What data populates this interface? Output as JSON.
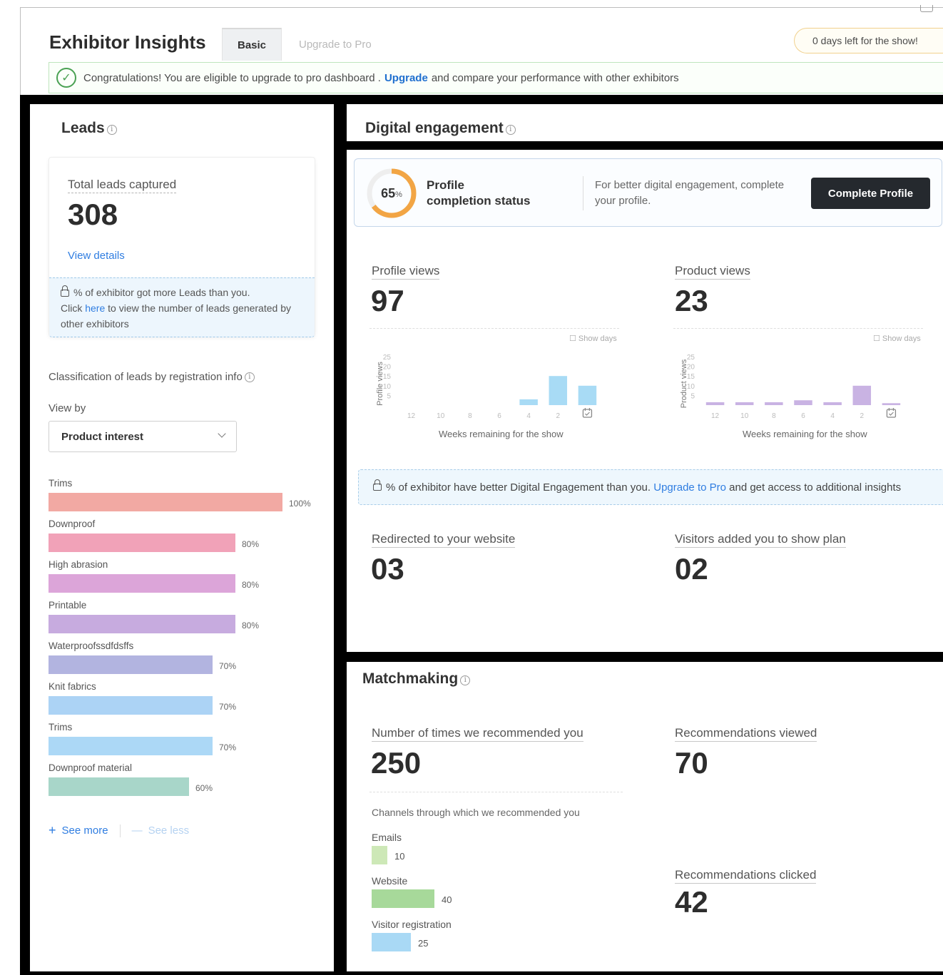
{
  "header": {
    "title": "Exhibitor Insights",
    "tabs": [
      {
        "label": "Basic"
      },
      {
        "label": "Upgrade to Pro"
      }
    ],
    "days_left": "0 days left for the show!",
    "banner": {
      "text_before": "Congratulations! You are eligible to upgrade to pro dashboard .",
      "link": "Upgrade",
      "text_after": "and compare your performance with other exhibitors"
    }
  },
  "leads": {
    "title": "Leads",
    "total_label": "Total leads captured",
    "total_value": "308",
    "view_details": "View details",
    "lock_line1": "% of exhibitor got more Leads than you.",
    "lock_click": "Click",
    "lock_here": "here",
    "lock_rest": "to view the number of leads generated by other exhibitors",
    "classification_title": "Classification of leads by registration info",
    "view_by_label": "View by",
    "view_by_value": "Product interest",
    "bars": [
      {
        "label": "Trims",
        "pct": 100,
        "pct_text": "100%",
        "color": "#f2a9a3"
      },
      {
        "label": "Downproof",
        "pct": 80,
        "pct_text": "80%",
        "color": "#f1a2b8"
      },
      {
        "label": "High abrasion",
        "pct": 80,
        "pct_text": "80%",
        "color": "#dca5d9"
      },
      {
        "label": "Printable",
        "pct": 80,
        "pct_text": "80%",
        "color": "#c7abdf"
      },
      {
        "label": "Waterproofssdfdsffs",
        "pct": 70,
        "pct_text": "70%",
        "color": "#b2b4e0"
      },
      {
        "label": "Knit fabrics",
        "pct": 70,
        "pct_text": "70%",
        "color": "#acd3f5"
      },
      {
        "label": "Trims",
        "pct": 70,
        "pct_text": "70%",
        "color": "#acd8f6"
      },
      {
        "label": "Downproof material",
        "pct": 60,
        "pct_text": "60%",
        "color": "#a8d6c9"
      }
    ],
    "see_more": "See more",
    "see_less": "See less"
  },
  "digital": {
    "title": "Digital engagement",
    "profile_pct": 65,
    "profile_pct_text": "65",
    "profile_pct_unit": "%",
    "profile_status_line1": "Profile",
    "profile_status_line2": "completion status",
    "profile_hint": "For better digital engagement, complete your profile.",
    "complete_button": "Complete Profile",
    "show_days": "Show days",
    "profile_views": {
      "label": "Profile views",
      "value": "97",
      "y_label": "Profile views",
      "x_caption": "Weeks remaining for the show"
    },
    "product_views": {
      "label": "Product views",
      "value": "23",
      "y_label": "Product views",
      "x_caption": "Weeks remaining for the show"
    },
    "banner": {
      "text": "% of exhibitor have better Digital Engagement than you.",
      "link": "Upgrade to Pro",
      "text_after": "and get access to additional insights"
    },
    "redirected": {
      "label": "Redirected to your website",
      "value": "03"
    },
    "show_plan": {
      "label": "Visitors added you to show plan",
      "value": "02"
    }
  },
  "chart_data": [
    {
      "type": "bar",
      "title": "",
      "xlabel": "Weeks remaining for the show",
      "ylabel": "Profile views",
      "categories": [
        "12",
        "10",
        "8",
        "6",
        "4",
        "2",
        "0"
      ],
      "values": [
        0,
        0,
        0,
        0,
        3,
        15,
        10
      ],
      "ylim": [
        0,
        25
      ],
      "yticks": [
        5,
        10,
        15,
        20,
        25
      ],
      "color": "#a8dbf5"
    },
    {
      "type": "bar",
      "title": "",
      "xlabel": "Weeks remaining for the show",
      "ylabel": "Product views",
      "categories": [
        "12",
        "10",
        "8",
        "6",
        "4",
        "2",
        "0"
      ],
      "values": [
        1.5,
        1.5,
        1.5,
        2.5,
        1.5,
        10,
        1
      ],
      "ylim": [
        0,
        25
      ],
      "yticks": [
        5,
        10,
        15,
        20,
        25
      ],
      "color": "#c9b3e3"
    }
  ],
  "matchmaking": {
    "title": "Matchmaking",
    "recommended": {
      "label": "Number of times we recommended you",
      "value": "250"
    },
    "viewed": {
      "label": "Recommendations viewed",
      "value": "70"
    },
    "clicked": {
      "label": "Recommendations clicked",
      "value": "42"
    },
    "channels_title": "Channels through which we recommended you",
    "channels": [
      {
        "label": "Emails",
        "value": 10,
        "value_text": "10",
        "color": "#cde8b7"
      },
      {
        "label": "Website",
        "value": 40,
        "value_text": "40",
        "color": "#a7d99a"
      },
      {
        "label": "Visitor registration",
        "value": 25,
        "value_text": "25",
        "color": "#a9d9f5"
      }
    ]
  }
}
